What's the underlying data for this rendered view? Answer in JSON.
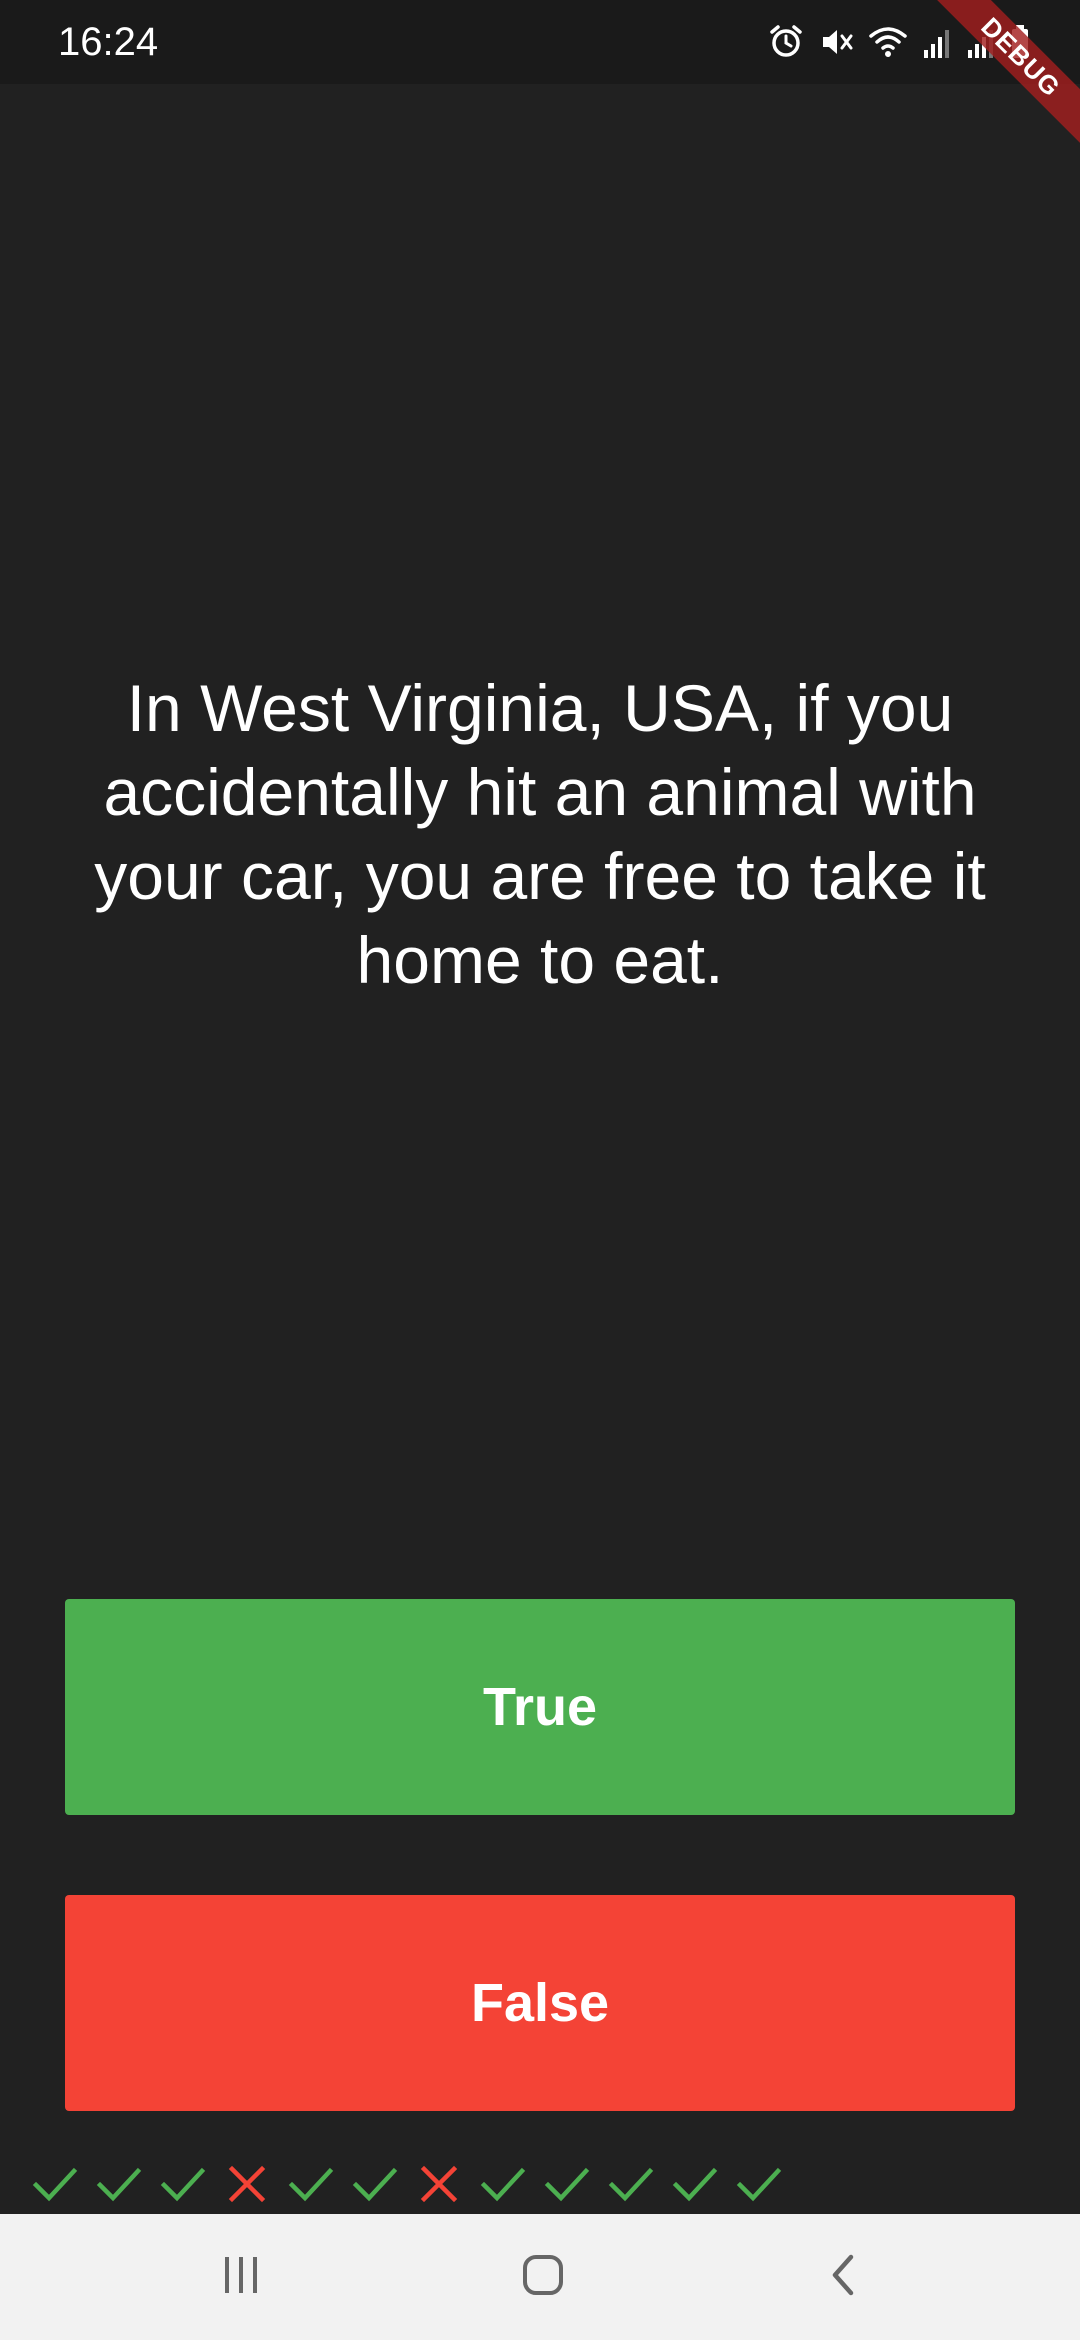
{
  "status_bar": {
    "time": "16:24",
    "icons": [
      "alarm-icon",
      "mute-icon",
      "wifi-icon",
      "signal-icon",
      "signal-icon-2",
      "battery-icon"
    ]
  },
  "debug_banner": {
    "label": "DEBUG"
  },
  "quiz": {
    "question": "In West Virginia, USA, if you accidentally hit an animal with your car, you are free to take it home to eat.",
    "true_label": "True",
    "false_label": "False",
    "score_keeper": [
      "correct",
      "correct",
      "correct",
      "wrong",
      "correct",
      "correct",
      "wrong",
      "correct",
      "correct",
      "correct",
      "correct",
      "correct"
    ]
  },
  "colors": {
    "background": "#212121",
    "true_button": "#4caf50",
    "false_button": "#f44336",
    "correct_mark": "#4caf50",
    "wrong_mark": "#f44336"
  },
  "nav_bar": {
    "icons": [
      "recents-icon",
      "home-icon",
      "back-icon"
    ]
  }
}
